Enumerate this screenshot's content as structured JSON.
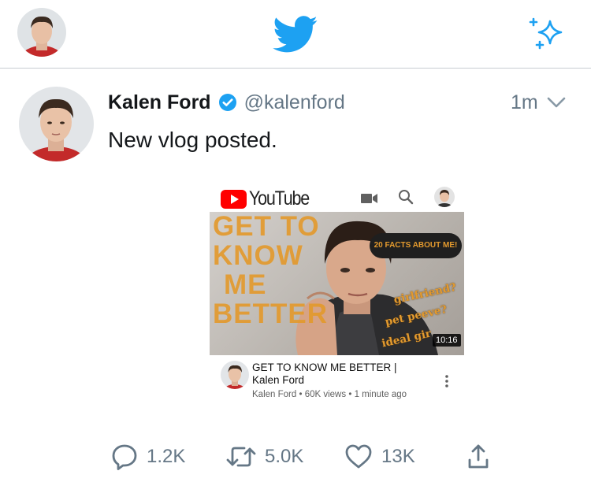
{
  "nav": {
    "logo_icon": "twitter-bird-icon",
    "sparkle_icon": "sparkle-icon",
    "brand_color": "#1da1f2"
  },
  "tweet": {
    "display_name": "Kalen Ford",
    "handle": "@kalenford",
    "time": "1m",
    "text": "New vlog posted.",
    "verified": true
  },
  "youtube": {
    "brand": "YouTube",
    "thumbnail": {
      "title_lines": [
        "GET TO",
        "KNOW",
        "ME",
        "BETTER"
      ],
      "facts_badge": "20 FACTS ABOUT ME!",
      "topics": [
        "girlfriend?",
        "pet peeve?",
        "ideal gir"
      ],
      "duration": "10:16"
    },
    "video_title": "GET TO KNOW ME BETTER | Kalen Ford",
    "channel": "Kalen Ford",
    "views": "60K views",
    "age": "1 minute ago",
    "accent": "#ff0000"
  },
  "actions": {
    "replies": "1.2K",
    "retweets": "5.0K",
    "likes": "13K",
    "share_icon": "share-icon"
  }
}
